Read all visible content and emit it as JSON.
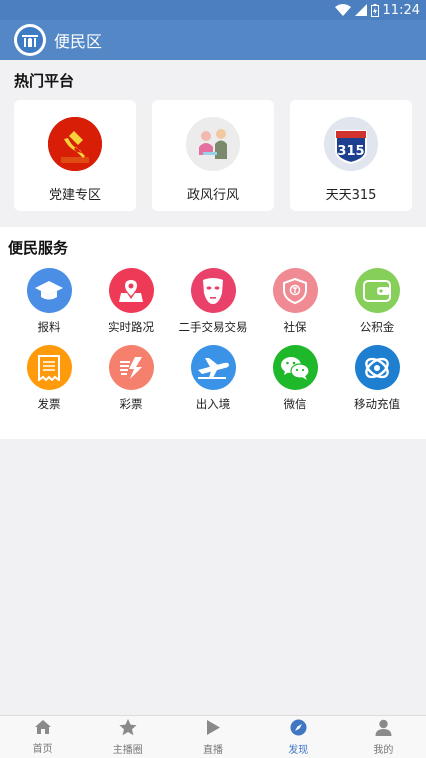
{
  "status": {
    "time": "11:24"
  },
  "header": {
    "title": "便民区"
  },
  "hot": {
    "title": "热门平台",
    "items": [
      {
        "label": "党建专区",
        "icon": "party-emblem-icon",
        "color": "#d81e06"
      },
      {
        "label": "政风行风",
        "icon": "meeting-people-icon",
        "color": "#e8e8e8"
      },
      {
        "label": "天天315",
        "icon": "shield-315-icon",
        "color": "#dde4ee"
      }
    ]
  },
  "services": {
    "title": "便民服务",
    "items": [
      {
        "label": "报料",
        "icon": "graduation-cap-icon",
        "color": "#4a8ee6"
      },
      {
        "label": "实时路况",
        "icon": "map-pin-icon",
        "color": "#ee3a57"
      },
      {
        "label": "二手交易交易",
        "icon": "mask-icon",
        "color": "#e9416a"
      },
      {
        "label": "社保",
        "icon": "shield-badge-icon",
        "color": "#f08a93"
      },
      {
        "label": "公积金",
        "icon": "wallet-icon",
        "color": "#86cf5a"
      },
      {
        "label": "发票",
        "icon": "receipt-icon",
        "color": "#ff9a0a"
      },
      {
        "label": "彩票",
        "icon": "lottery-icon",
        "color": "#f5806d"
      },
      {
        "label": "出入境",
        "icon": "airplane-icon",
        "color": "#3b93e8"
      },
      {
        "label": "微信",
        "icon": "wechat-icon",
        "color": "#20b82b"
      },
      {
        "label": "移动充值",
        "icon": "china-mobile-icon",
        "color": "#1e7fd0"
      }
    ]
  },
  "tabs": [
    {
      "label": "首页",
      "icon": "home-icon",
      "active": false
    },
    {
      "label": "主播圈",
      "icon": "star-icon",
      "active": false
    },
    {
      "label": "直播",
      "icon": "play-icon",
      "active": false
    },
    {
      "label": "发现",
      "icon": "compass-icon",
      "active": true
    },
    {
      "label": "我的",
      "icon": "user-icon",
      "active": false
    }
  ]
}
